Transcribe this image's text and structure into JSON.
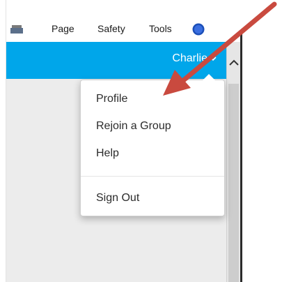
{
  "command_bar": {
    "page_label": "Page",
    "safety_label": "Safety",
    "tools_label": "Tools",
    "printer_icon": "printer-icon",
    "help_icon": "help-icon"
  },
  "header": {
    "user_name": "Charlie",
    "accent_color": "#00a6ea"
  },
  "user_menu": {
    "items": [
      {
        "label": "Profile"
      },
      {
        "label": "Rejoin a Group"
      },
      {
        "label": "Help"
      },
      {
        "label": "Sign Out"
      }
    ]
  },
  "annotation": {
    "arrow_color": "#c94a3f",
    "points_to": "Profile"
  }
}
